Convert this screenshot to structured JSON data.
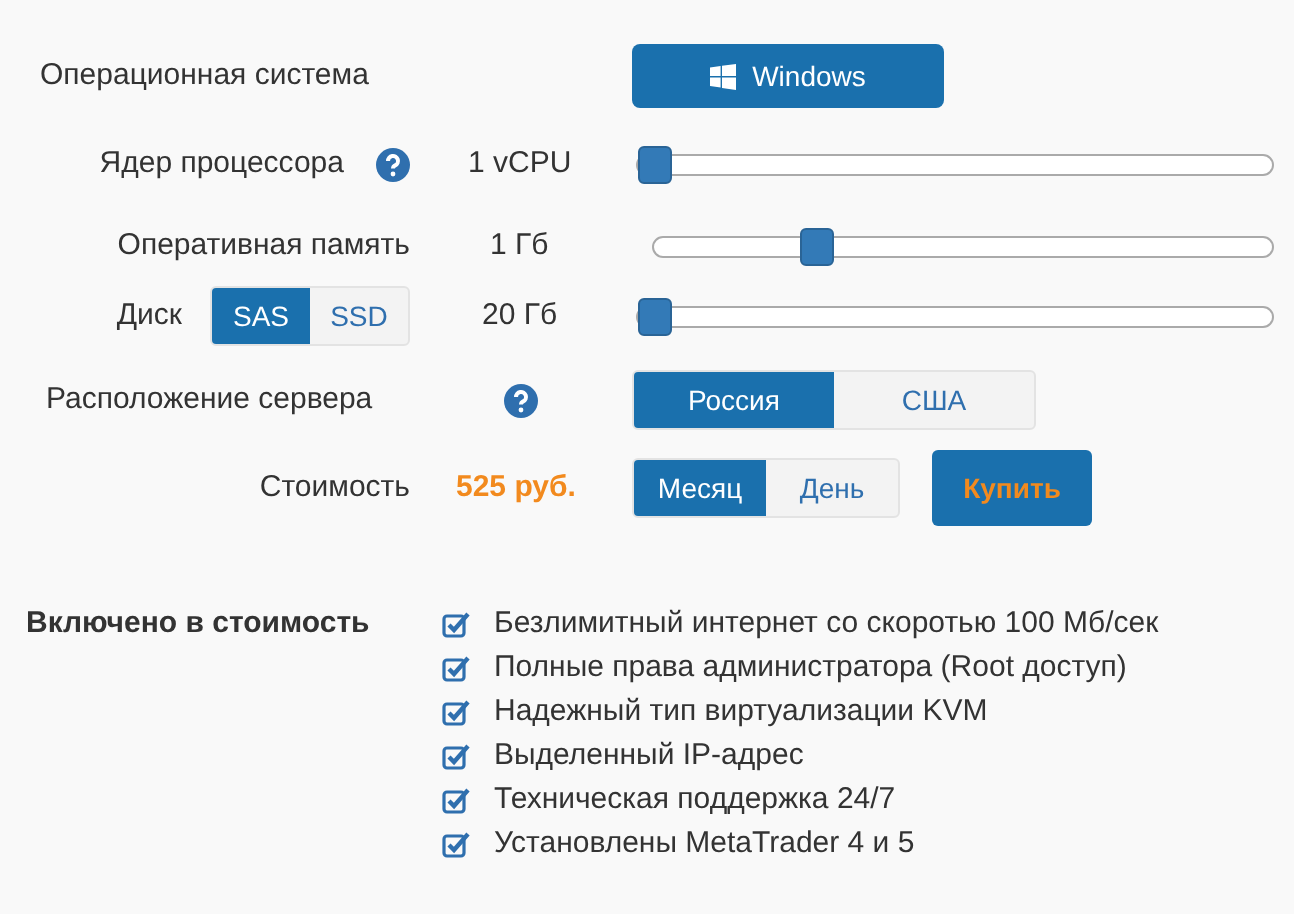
{
  "os": {
    "label": "Операционная система",
    "button": "Windows"
  },
  "cores": {
    "label": "Ядер процессора",
    "value": "1 vCPU",
    "level": 0
  },
  "ram": {
    "label": "Оперативная память",
    "value": "1 Гб",
    "level": 0.25
  },
  "disk": {
    "label": "Диск",
    "types": [
      {
        "label": "SAS",
        "selected": true
      },
      {
        "label": "SSD",
        "selected": false
      }
    ],
    "value": "20 Гб",
    "level": 0
  },
  "location": {
    "label": "Расположение сервера",
    "options": [
      {
        "label": "Россия",
        "selected": true
      },
      {
        "label": "США",
        "selected": false
      }
    ]
  },
  "cost": {
    "label": "Стоимость",
    "price": "525 руб.",
    "periods": [
      {
        "label": "Месяц",
        "selected": true
      },
      {
        "label": "День",
        "selected": false
      }
    ],
    "buy": "Купить"
  },
  "included": {
    "label": "Включено в стоимость",
    "items": [
      {
        "text": "Безлимитный интернет со скоротью 100 Мб/сек",
        "checked": true
      },
      {
        "text": "Полные права администратора (Root доступ)",
        "checked": true
      },
      {
        "text": "Надежный тип виртуализации KVM",
        "checked": true
      },
      {
        "text": "Выделенный IP-адрес",
        "checked": true
      },
      {
        "text": "Техническая поддержка 24/7",
        "checked": true
      },
      {
        "text": "Установлены MetaTrader 4 и 5",
        "checked": true
      }
    ]
  }
}
